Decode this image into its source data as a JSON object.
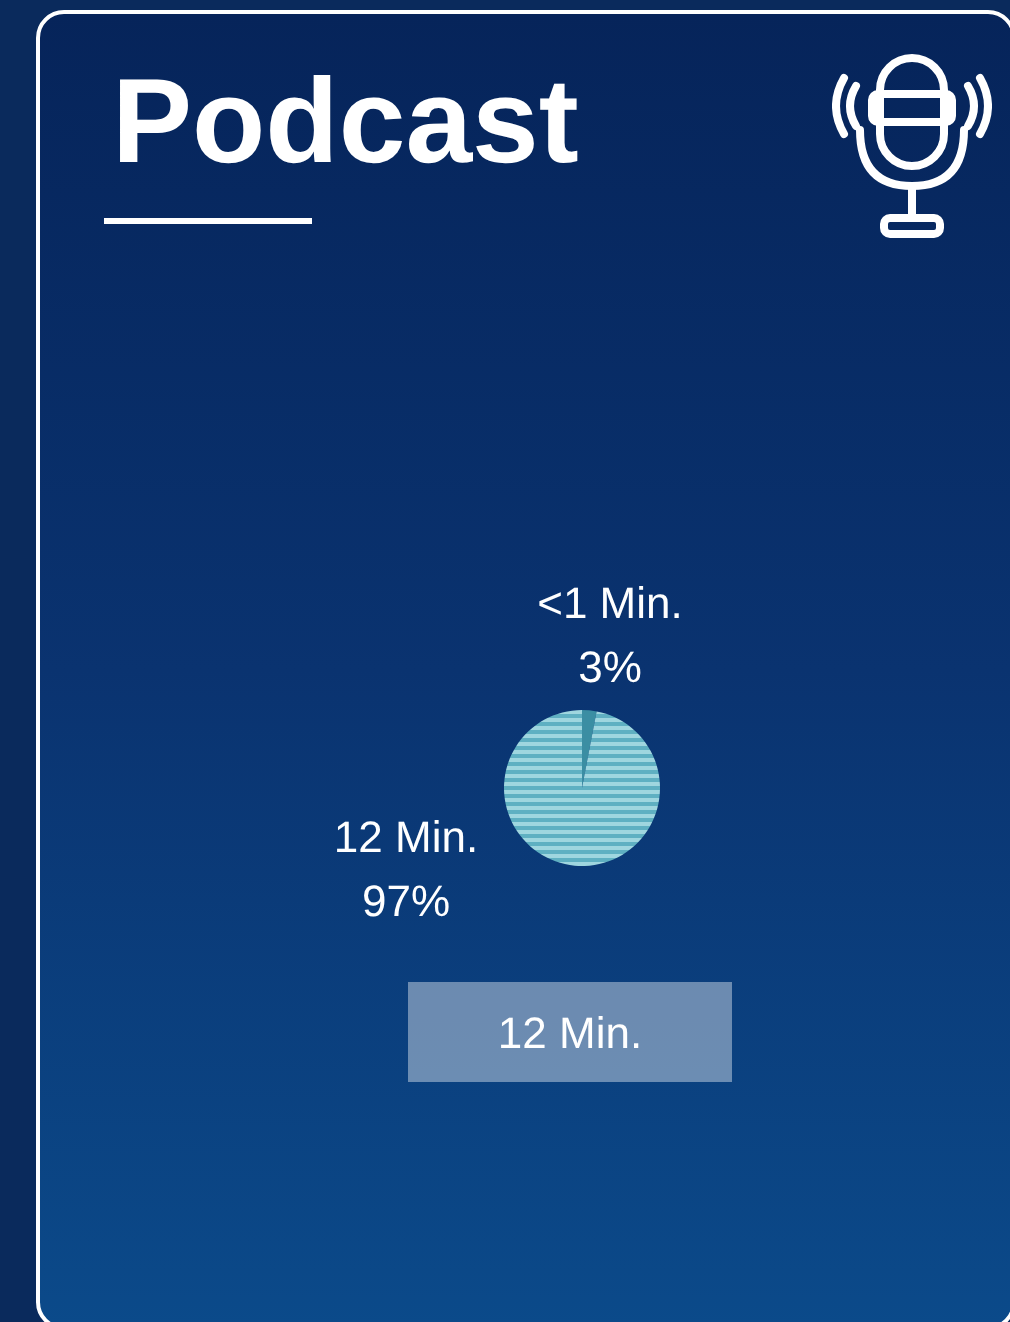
{
  "title": "Podcast",
  "chart": {
    "chart_data": {
      "type": "pie",
      "categories": [
        "<1 Min.",
        "12 Min."
      ],
      "values": [
        3,
        97
      ],
      "value_labels": [
        "3%",
        "97%"
      ],
      "data_labels": true
    },
    "legend": [
      {
        "label": "12 Min."
      }
    ]
  }
}
